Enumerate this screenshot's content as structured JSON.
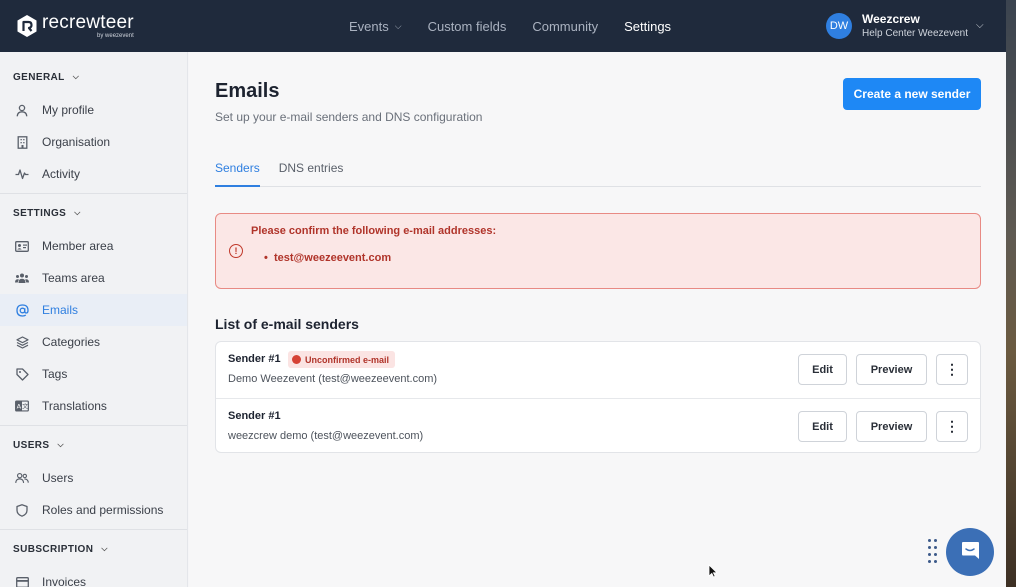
{
  "brand": {
    "name": "recrewteer",
    "sub": "by weezevent"
  },
  "nav": {
    "items": [
      {
        "label": "Events",
        "has_dropdown": true
      },
      {
        "label": "Custom fields"
      },
      {
        "label": "Community"
      },
      {
        "label": "Settings",
        "active": true
      }
    ]
  },
  "user": {
    "initials": "DW",
    "name": "Weezcrew",
    "org": "Help Center Weezevent"
  },
  "sidebar": {
    "sections": [
      {
        "title": "GENERAL",
        "items": [
          {
            "label": "My profile",
            "icon": "person-icon"
          },
          {
            "label": "Organisation",
            "icon": "building-icon"
          },
          {
            "label": "Activity",
            "icon": "activity-icon"
          }
        ]
      },
      {
        "title": "SETTINGS",
        "items": [
          {
            "label": "Member area",
            "icon": "id-card-icon"
          },
          {
            "label": "Teams area",
            "icon": "team-icon"
          },
          {
            "label": "Emails",
            "icon": "at-icon",
            "active": true
          },
          {
            "label": "Categories",
            "icon": "layers-icon"
          },
          {
            "label": "Tags",
            "icon": "tag-icon"
          },
          {
            "label": "Translations",
            "icon": "translate-icon"
          }
        ]
      },
      {
        "title": "USERS",
        "items": [
          {
            "label": "Users",
            "icon": "users-icon"
          },
          {
            "label": "Roles and permissions",
            "icon": "shield-icon"
          }
        ]
      },
      {
        "title": "SUBSCRIPTION",
        "items": [
          {
            "label": "Invoices",
            "icon": "invoice-icon"
          }
        ]
      }
    ]
  },
  "main": {
    "title": "Emails",
    "subtitle": "Set up your e-mail senders and DNS configuration",
    "create_button": "Create a new sender",
    "tabs": [
      {
        "label": "Senders",
        "active": true
      },
      {
        "label": "DNS entries"
      }
    ],
    "alert": {
      "title": "Please confirm the following e-mail addresses:",
      "items": [
        "test@weezeevent.com"
      ]
    },
    "list_title": "List of e-mail senders",
    "senders": [
      {
        "name": "Sender #1",
        "badge": "Unconfirmed e-mail",
        "detail": "Demo Weezevent (test@weezeevent.com)"
      },
      {
        "name": "Sender #1",
        "badge": null,
        "detail": "weezcrew demo (test@weezevent.com)"
      }
    ],
    "row_buttons": {
      "edit": "Edit",
      "preview": "Preview",
      "more": "⋮"
    }
  },
  "colors": {
    "nav_bg": "#1f2a3c",
    "accent": "#1e88f5",
    "alert_bg": "#fbe7e6",
    "alert_text": "#b0342a"
  }
}
